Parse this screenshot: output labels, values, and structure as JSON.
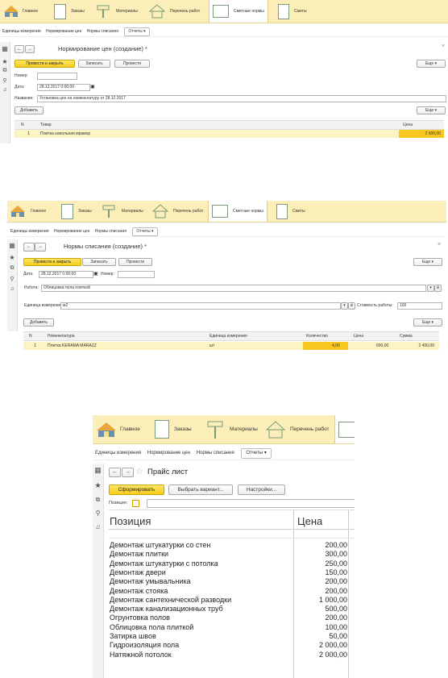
{
  "nav": {
    "sections": [
      "Главное",
      "Заказы",
      "Материалы",
      "Перечень работ",
      "Сметные нормы",
      "Сметы"
    ],
    "subnav": [
      "Единицы измерения",
      "Нормирование цен",
      "Нормы списания"
    ],
    "reports": "Отчеты",
    "chevron": "▾"
  },
  "icons": {
    "grid": "apps-grid-icon",
    "star": "favorites-icon",
    "history": "history-icon",
    "search": "search-icon",
    "bell": "notifications-icon"
  },
  "colors": {
    "accent": "#f5cc1a",
    "topbar": "#fbeeb8",
    "highlight": "#f8c820",
    "row": "#fdf4c4"
  },
  "form1": {
    "title": "Нормирование цен (создание) *",
    "close": "×",
    "buttons": {
      "post_close": "Провести и закрыть",
      "save": "Записать",
      "post": "Провести",
      "more": "Еще",
      "add": "Добавить"
    },
    "labels": {
      "number": "Номер:",
      "date": "Дата:",
      "name": "Название:"
    },
    "values": {
      "number": "",
      "date": "28.12.2017  0:00:00",
      "name": "Установка цен на номенклатуру от 28.12.2017"
    },
    "columns": [
      "N",
      "Товар",
      "Цена"
    ],
    "rows": [
      {
        "n": "1",
        "item": "Плитка напольная мрамор",
        "price": "2 500,00"
      }
    ]
  },
  "form2": {
    "title": "Нормы списания  (создание) *",
    "close": "×",
    "buttons": {
      "post_close": "Провести и закрыть",
      "save": "Записать",
      "post": "Провести",
      "more": "Еще",
      "add": "Добавить"
    },
    "labels": {
      "date": "Дата:",
      "number": "Номер:",
      "work": "Работа:",
      "unit": "Единица измерения:",
      "cost": "Стоимость работы:"
    },
    "values": {
      "date": "28.12.2017  0:00:00",
      "number": "",
      "work": "Облицовка пола плиткой",
      "unit": "м2",
      "cost": "100"
    },
    "columns": [
      "N",
      "Номенклатура",
      "Единица измерения",
      "Количество",
      "Цена",
      "Сумма"
    ],
    "rows": [
      {
        "n": "1",
        "item": "Плитка KERAMA MARAZZ",
        "unit": "шт",
        "qty": "4,00",
        "price": "600,00",
        "sum": "2 400,00"
      }
    ]
  },
  "form3": {
    "title": "Прайс лист",
    "buttons": {
      "generate": "Сформировать",
      "variant": "Выбрать вариант...",
      "settings": "Настройки..."
    },
    "position_label": "Позиция:",
    "columns": [
      "Позиция",
      "Цена"
    ],
    "rows": [
      {
        "name": "Демонтаж штукатурки со стен",
        "price": "200,00"
      },
      {
        "name": "Демонтаж плитки",
        "price": "300,00"
      },
      {
        "name": "Демонтаж штукатурки с потолка",
        "price": "250,00"
      },
      {
        "name": "Демонтаж двери",
        "price": "150,00"
      },
      {
        "name": "Демонтаж умывальника",
        "price": "200,00"
      },
      {
        "name": "Демонтаж стояка",
        "price": "200,00"
      },
      {
        "name": "Демонтаж сантехнической разводки",
        "price": "1 000,00"
      },
      {
        "name": "Демонтаж канализационных труб",
        "price": "500,00"
      },
      {
        "name": "Огрунтовка полов",
        "price": "200,00"
      },
      {
        "name": "Облицовка пола плиткой",
        "price": "100,00"
      },
      {
        "name": "Затирка швов",
        "price": "50,00"
      },
      {
        "name": "Гидроизоляция пола",
        "price": "2 000,00"
      },
      {
        "name": "Натяжной потолок",
        "price": "2 000,00"
      }
    ]
  }
}
